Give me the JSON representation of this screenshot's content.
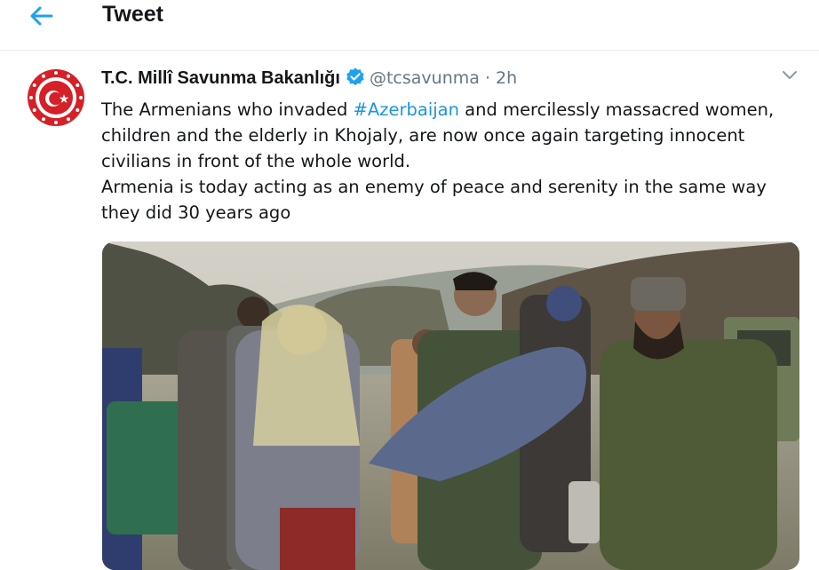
{
  "header": {
    "title": "Tweet",
    "back_icon": "arrow-left-icon"
  },
  "tweet": {
    "author_name": "T.C. Millî Savunma Bakanlığı",
    "verified_icon": "verified-badge-icon",
    "handle": "@tcsavunma",
    "separator": "·",
    "time": "2h",
    "menu_icon": "chevron-down-icon",
    "text": {
      "para1_before": "The Armenians who invaded ",
      "hashtag": "#Azerbaijan",
      "para1_after": " and mercilessly massacred women, children and the elderly in Khojaly, are now once again targeting innocent civilians in front of the whole world.",
      "para2": "Armenia is today acting as an enemy of peace and serenity in the same way they did 30 years ago"
    },
    "media_icon": "photo"
  },
  "colors": {
    "accent": "#1da1f2",
    "hashtag": "#1b95e0",
    "muted": "#657786",
    "avatar_red": "#d62027"
  }
}
